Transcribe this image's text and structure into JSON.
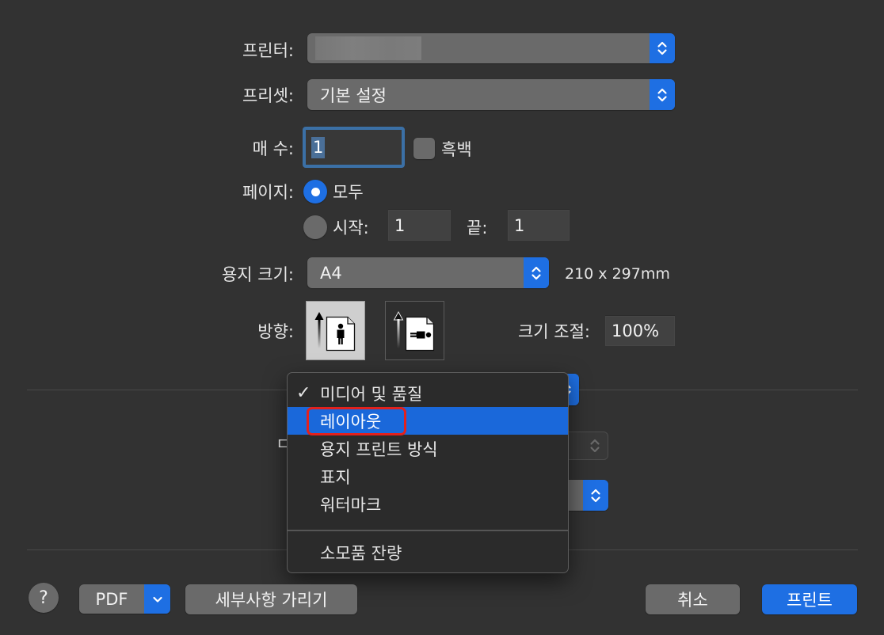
{
  "colors": {
    "background": "#323232",
    "control": "#6a6a6a",
    "accent": "#1e6fe3",
    "text": "#e6e6e6",
    "field": "#414141",
    "focus_ring": "#3b70a6",
    "selection": "#4a6f98",
    "menu_background": "#2b2b2b",
    "menu_highlight": "#1a68da",
    "annotation": "#e3211d",
    "separator": "#4a4a4a"
  },
  "printer": {
    "label": "프린터:",
    "name_obscured": true
  },
  "preset": {
    "label": "프리셋:",
    "value": "기본 설정"
  },
  "copies": {
    "label": "매 수:",
    "value": "1",
    "black_and_white": {
      "label": "흑백",
      "checked": false
    }
  },
  "pages": {
    "label": "페이지:",
    "all": {
      "label": "모두",
      "selected": true
    },
    "range": {
      "selected": false,
      "from_label": "시작:",
      "from_value": "1",
      "to_label": "끝:",
      "to_value": "1"
    }
  },
  "paper_size": {
    "label": "용지 크기:",
    "value": "A4",
    "dimensions": "210 x 297mm"
  },
  "orientation": {
    "label": "방향:",
    "options": [
      {
        "icon": "portrait-orientation-icon",
        "selected": true
      },
      {
        "icon": "landscape-orientation-icon",
        "selected": false
      }
    ]
  },
  "scale": {
    "label": "크기 조절:",
    "value": "100%"
  },
  "occluded_label_fragment": "ㄷ",
  "section_menu": {
    "check_glyph": "✓",
    "items": [
      {
        "label": "미디어 및 품질",
        "checked": true,
        "highlighted": false
      },
      {
        "label": "레이아웃",
        "checked": false,
        "highlighted": true,
        "annotated": true
      },
      {
        "label": "용지 프린트 방식",
        "checked": false,
        "highlighted": false
      },
      {
        "label": "표지",
        "checked": false,
        "highlighted": false
      },
      {
        "label": "워터마크",
        "checked": false,
        "highlighted": false
      }
    ],
    "footer_items": [
      {
        "label": "소모품 잔량",
        "checked": false,
        "highlighted": false
      }
    ]
  },
  "footer": {
    "help": "?",
    "pdf": "PDF",
    "hide_details": "세부사항 가리기",
    "cancel": "취소",
    "print": "프린트"
  }
}
